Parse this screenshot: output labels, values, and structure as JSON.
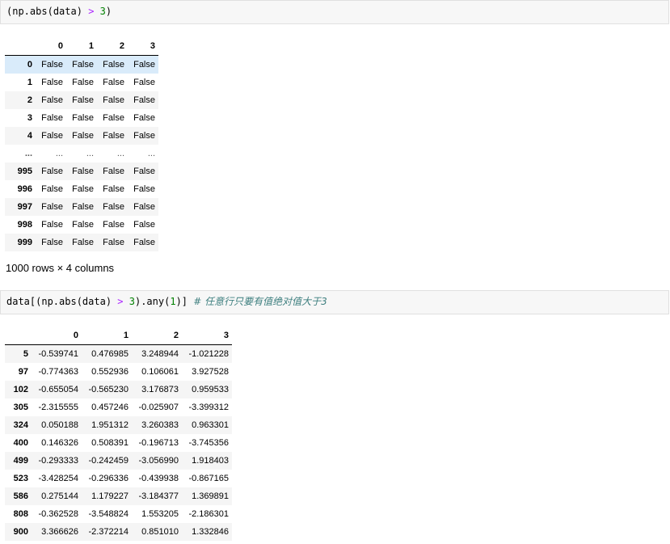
{
  "cell1": {
    "open_paren": "(",
    "func": "np.abs",
    "arg": "(data)",
    "op": ">",
    "num": "3",
    "close_paren": ")"
  },
  "bool_table": {
    "columns": [
      "0",
      "1",
      "2",
      "3"
    ],
    "rows": [
      {
        "index": "0",
        "values": [
          "False",
          "False",
          "False",
          "False"
        ]
      },
      {
        "index": "1",
        "values": [
          "False",
          "False",
          "False",
          "False"
        ]
      },
      {
        "index": "2",
        "values": [
          "False",
          "False",
          "False",
          "False"
        ]
      },
      {
        "index": "3",
        "values": [
          "False",
          "False",
          "False",
          "False"
        ]
      },
      {
        "index": "4",
        "values": [
          "False",
          "False",
          "False",
          "False"
        ]
      },
      {
        "index": "...",
        "values": [
          "...",
          "...",
          "...",
          "..."
        ]
      },
      {
        "index": "995",
        "values": [
          "False",
          "False",
          "False",
          "False"
        ]
      },
      {
        "index": "996",
        "values": [
          "False",
          "False",
          "False",
          "False"
        ]
      },
      {
        "index": "997",
        "values": [
          "False",
          "False",
          "False",
          "False"
        ]
      },
      {
        "index": "998",
        "values": [
          "False",
          "False",
          "False",
          "False"
        ]
      },
      {
        "index": "999",
        "values": [
          "False",
          "False",
          "False",
          "False"
        ]
      }
    ],
    "shape_note": "1000 rows × 4 columns"
  },
  "cell2": {
    "part1": "data[(np.abs(data) ",
    "op": ">",
    "part2": " ",
    "num": "3",
    "part3": ").any(",
    "num2": "1",
    "part4": ")] ",
    "comment": "# 任意行只要有值绝对值大于3"
  },
  "val_table": {
    "columns": [
      "0",
      "1",
      "2",
      "3"
    ],
    "rows": [
      {
        "index": "5",
        "values": [
          "-0.539741",
          "0.476985",
          "3.248944",
          "-1.021228"
        ]
      },
      {
        "index": "97",
        "values": [
          "-0.774363",
          "0.552936",
          "0.106061",
          "3.927528"
        ]
      },
      {
        "index": "102",
        "values": [
          "-0.655054",
          "-0.565230",
          "3.176873",
          "0.959533"
        ]
      },
      {
        "index": "305",
        "values": [
          "-2.315555",
          "0.457246",
          "-0.025907",
          "-3.399312"
        ]
      },
      {
        "index": "324",
        "values": [
          "0.050188",
          "1.951312",
          "3.260383",
          "0.963301"
        ]
      },
      {
        "index": "400",
        "values": [
          "0.146326",
          "0.508391",
          "-0.196713",
          "-3.745356"
        ]
      },
      {
        "index": "499",
        "values": [
          "-0.293333",
          "-0.242459",
          "-3.056990",
          "1.918403"
        ]
      },
      {
        "index": "523",
        "values": [
          "-3.428254",
          "-0.296336",
          "-0.439938",
          "-0.867165"
        ]
      },
      {
        "index": "586",
        "values": [
          "0.275144",
          "1.179227",
          "-3.184377",
          "1.369891"
        ]
      },
      {
        "index": "808",
        "values": [
          "-0.362528",
          "-3.548824",
          "1.553205",
          "-2.186301"
        ]
      },
      {
        "index": "900",
        "values": [
          "3.366626",
          "-2.372214",
          "0.851010",
          "1.332846"
        ]
      }
    ]
  },
  "colors": {
    "code_bg": "#f7f7f7",
    "operator": "#aa22ff",
    "number": "#008000",
    "comment": "#408080",
    "row_highlight": "#d9ebfa",
    "row_stripe": "#f5f5f5"
  }
}
